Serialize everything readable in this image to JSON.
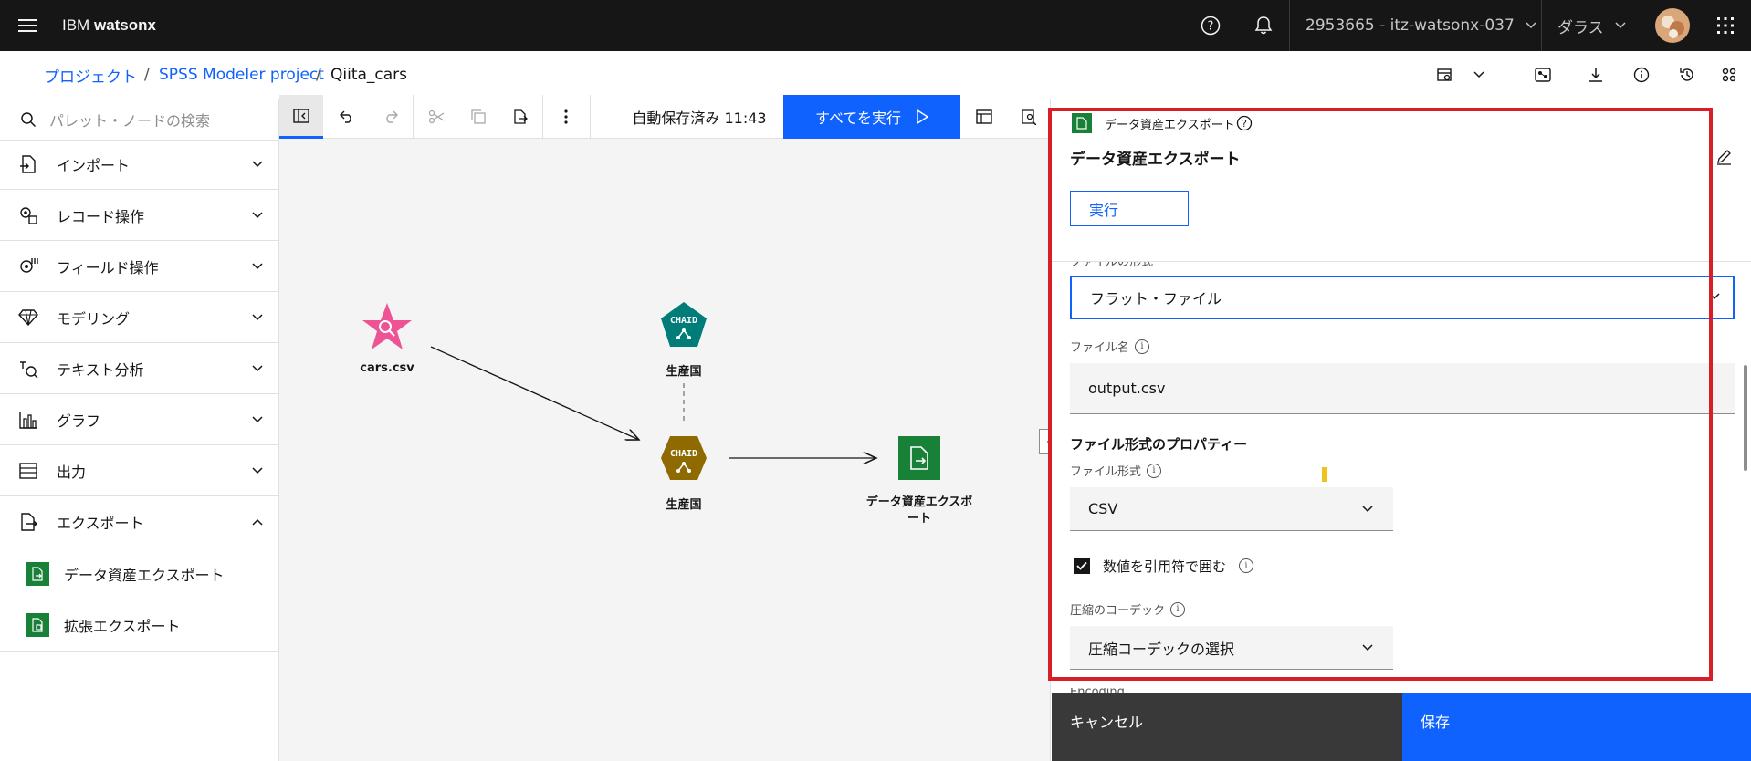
{
  "topbar": {
    "brand_prefix": "IBM",
    "brand_name": "watsonx",
    "account": "2953665 - itz-watsonx-037",
    "region": "ダラス",
    "icons": [
      "menu-icon",
      "help-icon",
      "notification-icon",
      "chevron-down-icon",
      "avatar",
      "app-switcher-icon"
    ]
  },
  "breadcrumb": {
    "items": [
      "プロジェクト",
      "SPSS Modeler project",
      "Qiita_cars"
    ],
    "separator": "/"
  },
  "right_icons": [
    "flow-settings-icon",
    "chevron-down-icon",
    "model-icon",
    "download-icon",
    "info-icon",
    "history-icon",
    "settings-icon"
  ],
  "sidebar": {
    "search_placeholder": "パレット・ノードの検索",
    "categories": [
      {
        "label": "インポート",
        "icon": "import-icon",
        "expanded": false
      },
      {
        "label": "レコード操作",
        "icon": "record-ops-icon",
        "expanded": false
      },
      {
        "label": "フィールド操作",
        "icon": "field-ops-icon",
        "expanded": false
      },
      {
        "label": "モデリング",
        "icon": "modeling-icon",
        "expanded": false
      },
      {
        "label": "テキスト分析",
        "icon": "text-analysis-icon",
        "expanded": false
      },
      {
        "label": "グラフ",
        "icon": "graph-icon",
        "expanded": false
      },
      {
        "label": "出力",
        "icon": "output-icon",
        "expanded": false
      },
      {
        "label": "エクスポート",
        "icon": "export-icon",
        "expanded": true
      }
    ],
    "export_items": [
      "データ資産エクスポート",
      "拡張エクスポート"
    ]
  },
  "toolbar": {
    "autosave": "自動保存済み 11:43",
    "run_all": "すべてを実行"
  },
  "canvas": {
    "nodes": [
      {
        "label": "cars.csv",
        "type": "source"
      },
      {
        "label": "生産国",
        "type": "chaid-model",
        "badge": "CHAID"
      },
      {
        "label": "生産国",
        "type": "chaid-nugget",
        "badge": "CHAID"
      },
      {
        "label": "データ資産エクスポート",
        "type": "export"
      }
    ]
  },
  "panel": {
    "node_type": "データ資産エクスポート",
    "title": "データ資産エクスポート",
    "run_label": "実行",
    "cut_label": "ファイルの形式",
    "file_type_value": "フラット・ファイル",
    "file_name_label": "ファイル名",
    "file_name_value": "output.csv",
    "section_title": "ファイル形式のプロパティー",
    "file_format_label": "ファイル形式",
    "file_format_value": "CSV",
    "quote_label": "数値を引用符で囲む",
    "quote_checked": true,
    "codec_label": "圧縮のコーデック",
    "codec_value": "圧縮コーデックの選択",
    "next_label": "Encoding",
    "cancel": "キャンセル",
    "save": "保存"
  },
  "colors": {
    "accent": "#0f62fe",
    "topbar": "#161616",
    "export_green": "#198038",
    "chaid_teal": "#007d79",
    "chaid_gold": "#8e6a00",
    "source_pink": "#ee5396",
    "highlight_red": "#da1e28"
  }
}
